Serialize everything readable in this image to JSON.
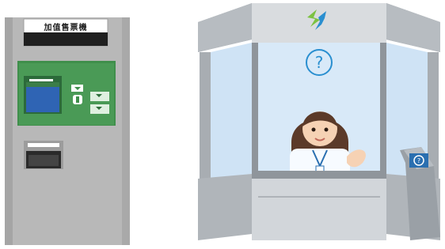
{
  "machine": {
    "sign_label": "加值售票機",
    "screen_color": "#2f64b4",
    "panel_color": "#4a9a56"
  },
  "booth": {
    "logo_icon": "lightning-bolt-logo-icon",
    "help_bubble_icon": "question-mark-icon",
    "kiosk_icon": "question-mark-icon",
    "glass_color": "#cfe3f5",
    "frame_color": "#9aa0a6"
  },
  "colors": {
    "logo_green": "#7cc242",
    "logo_blue": "#2a8fd0",
    "accent_blue": "#2a6fb0"
  }
}
